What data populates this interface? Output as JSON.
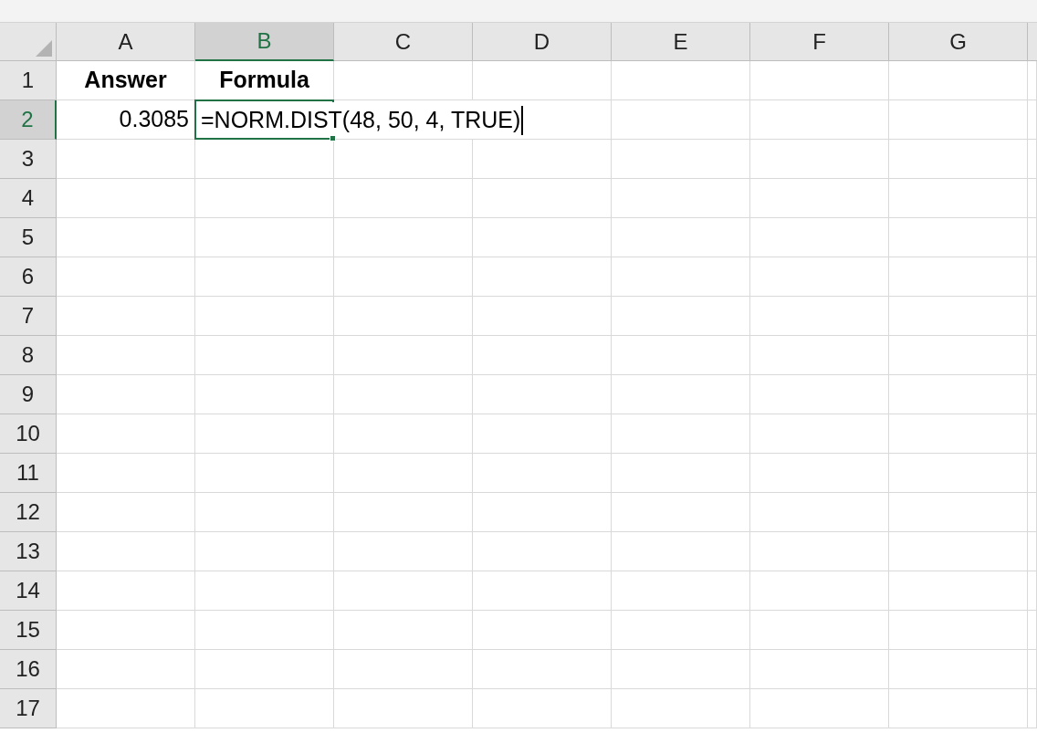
{
  "columns": [
    {
      "label": "A",
      "selected": false
    },
    {
      "label": "B",
      "selected": true
    },
    {
      "label": "C",
      "selected": false
    },
    {
      "label": "D",
      "selected": false
    },
    {
      "label": "E",
      "selected": false
    },
    {
      "label": "F",
      "selected": false
    },
    {
      "label": "G",
      "selected": false
    }
  ],
  "rows": [
    {
      "label": "1",
      "selected": false,
      "cells": [
        {
          "kind": "header",
          "text": "Answer"
        },
        {
          "kind": "header",
          "text": "Formula"
        }
      ]
    },
    {
      "label": "2",
      "selected": true,
      "cells": [
        {
          "kind": "number",
          "text": "0.3085"
        },
        {
          "kind": "editing",
          "text": "=NORM.DIST(48, 50, 4, TRUE)"
        }
      ]
    },
    {
      "label": "3",
      "selected": false,
      "cells": []
    },
    {
      "label": "4",
      "selected": false,
      "cells": []
    },
    {
      "label": "5",
      "selected": false,
      "cells": []
    },
    {
      "label": "6",
      "selected": false,
      "cells": []
    },
    {
      "label": "7",
      "selected": false,
      "cells": []
    },
    {
      "label": "8",
      "selected": false,
      "cells": []
    },
    {
      "label": "9",
      "selected": false,
      "cells": []
    },
    {
      "label": "10",
      "selected": false,
      "cells": []
    },
    {
      "label": "11",
      "selected": false,
      "cells": []
    },
    {
      "label": "12",
      "selected": false,
      "cells": []
    },
    {
      "label": "13",
      "selected": false,
      "cells": []
    },
    {
      "label": "14",
      "selected": false,
      "cells": []
    },
    {
      "label": "15",
      "selected": false,
      "cells": []
    },
    {
      "label": "16",
      "selected": false,
      "cells": []
    },
    {
      "label": "17",
      "selected": false,
      "cells": []
    }
  ]
}
